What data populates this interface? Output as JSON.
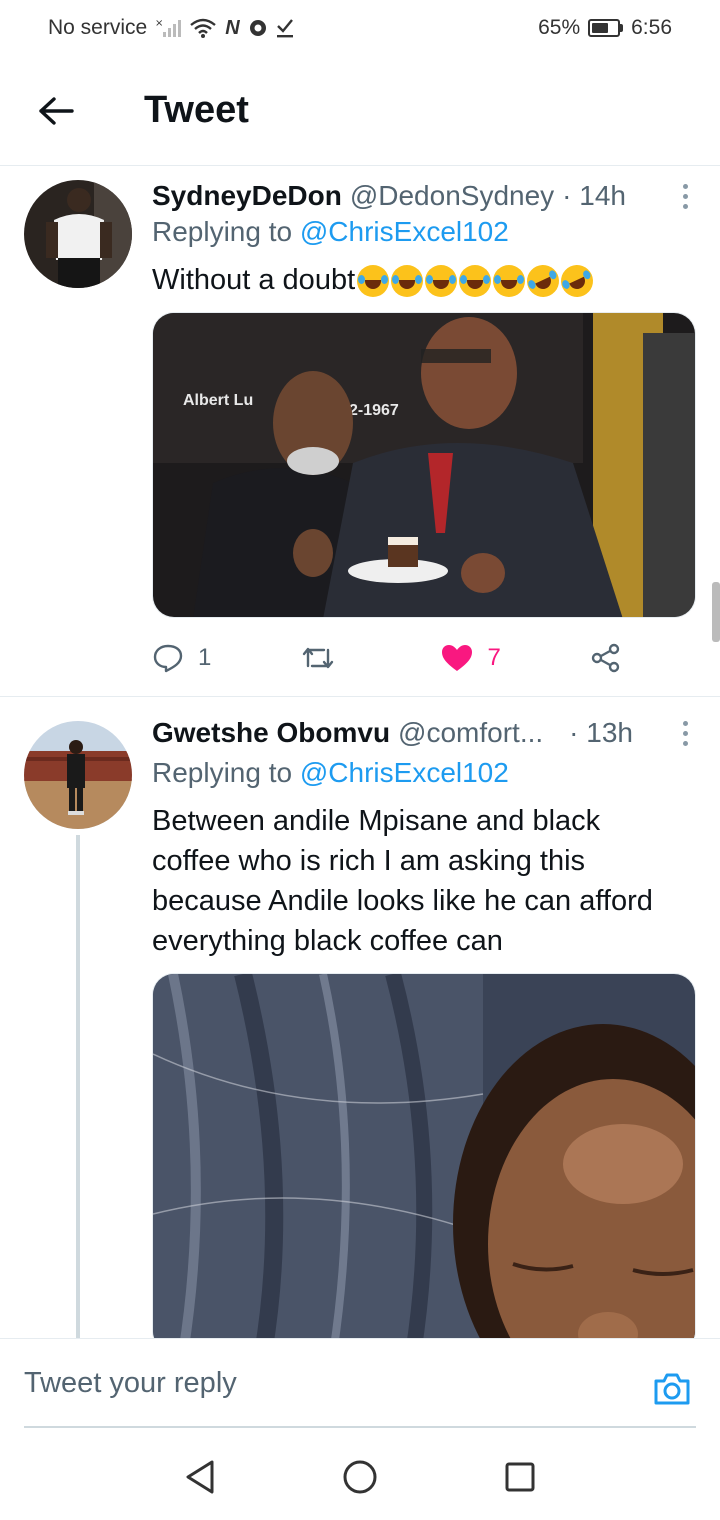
{
  "status_bar": {
    "carrier": "No service",
    "battery": "65%",
    "battery_level": 0.65,
    "time": "6:56"
  },
  "header": {
    "title": "Tweet"
  },
  "tweets": [
    {
      "display_name": "SydneyDeDon",
      "handle": "@DedonSydney",
      "time": "· 14h",
      "replying_prefix": "Replying to",
      "replying_handle": "@ChrisExcel102",
      "text": "Without a doubt",
      "emojis": [
        "joy",
        "joy",
        "joy",
        "joy",
        "joy",
        "rofl",
        "rofl"
      ],
      "image_text": [
        "Albert Lu",
        "2-1967"
      ],
      "reply_count": "1",
      "retweet_count": "",
      "like_count": "7"
    },
    {
      "display_name": "Gwetshe Obomvu",
      "handle": "@comfort...",
      "time": "· 13h",
      "replying_prefix": "Replying to",
      "replying_handle": "@ChrisExcel102",
      "text_lines": [
        "Between andile Mpisane and black",
        "coffee who is rich I am asking this",
        "because Andile looks like he can afford",
        "everything black coffee can"
      ]
    }
  ],
  "reply_bar": {
    "placeholder": "Tweet your reply"
  },
  "colors": {
    "accent": "#1d9bf0",
    "like": "#f91880",
    "secondary_text": "#536471"
  }
}
